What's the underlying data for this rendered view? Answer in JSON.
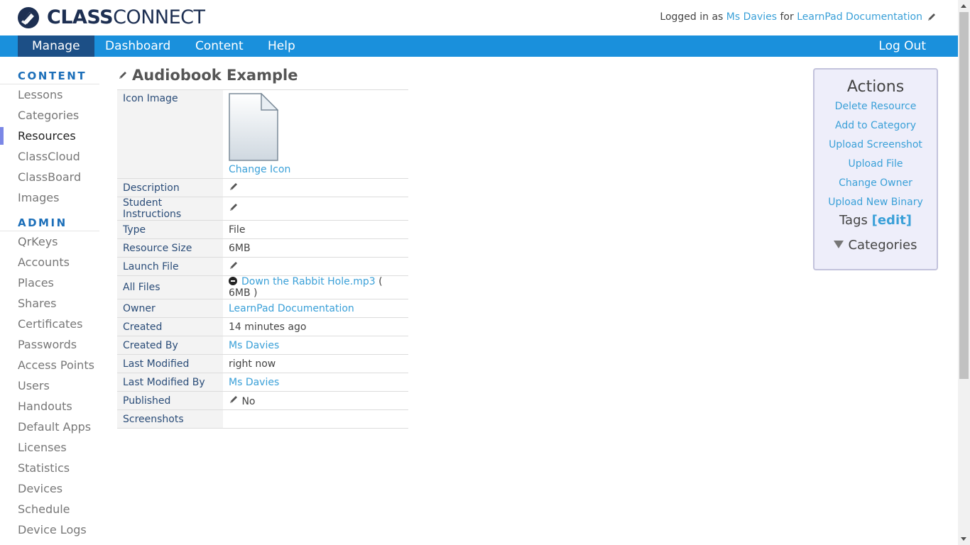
{
  "brand": {
    "text_bold": "CLASS",
    "text_light": "CONNECT",
    "color": "#1d2f52"
  },
  "login": {
    "prefix": "Logged in as ",
    "user": "Ms Davies",
    "middle": " for ",
    "org": "LearnPad Documentation"
  },
  "nav": {
    "items": [
      "Manage",
      "Dashboard",
      "Content",
      "Help"
    ],
    "active": "Manage",
    "logout": "Log Out",
    "color": "#1a90dc",
    "active_color": "#1c4f86"
  },
  "sidebar": {
    "content_heading": "CONTENT",
    "content_items": [
      "Lessons",
      "Categories",
      "Resources",
      "ClassCloud",
      "ClassBoard",
      "Images"
    ],
    "active": "Resources",
    "admin_heading": "ADMIN",
    "admin_items": [
      "QrKeys",
      "Accounts",
      "Places",
      "Shares",
      "Certificates",
      "Passwords",
      "Access Points",
      "Users",
      "Handouts",
      "Default Apps",
      "Licenses",
      "Statistics",
      "Devices",
      "Schedule",
      "Device Logs"
    ]
  },
  "resource": {
    "title": "Audiobook Example",
    "icon_label": "Icon Image",
    "change_icon": "Change Icon",
    "rows": {
      "description": {
        "label": "Description"
      },
      "student_instructions": {
        "label": "Student Instructions"
      },
      "type": {
        "label": "Type",
        "value": "File"
      },
      "resource_size": {
        "label": "Resource Size",
        "value": "6MB"
      },
      "launch_file": {
        "label": "Launch File"
      },
      "all_files": {
        "label": "All Files",
        "file_name": "Down the Rabbit Hole.mp3",
        "file_size": "( 6MB )"
      },
      "owner": {
        "label": "Owner",
        "value": "LearnPad Documentation"
      },
      "created": {
        "label": "Created",
        "value": "14 minutes ago"
      },
      "created_by": {
        "label": "Created By",
        "value": "Ms Davies"
      },
      "last_modified": {
        "label": "Last Modified",
        "value": "right now"
      },
      "last_modified_by": {
        "label": "Last Modified By",
        "value": "Ms Davies"
      },
      "published": {
        "label": "Published",
        "value": "No"
      },
      "screenshots": {
        "label": "Screenshots"
      }
    }
  },
  "actions": {
    "heading": "Actions",
    "links": [
      "Delete Resource",
      "Add to Category",
      "Upload Screenshot",
      "Upload File",
      "Change Owner",
      "Upload New Binary"
    ],
    "tags_label": "Tags",
    "tags_edit": "[edit]",
    "categories_label": "Categories"
  },
  "icons": {
    "logo": "classconnect-logo-icon",
    "pencil": "pencil-icon",
    "file": "blank-file-icon",
    "remove": "minus-circle-icon",
    "collapse": "triangle-down-icon"
  },
  "colors": {
    "link": "#3aa0d8",
    "label": "#2a4c78",
    "actions_bg": "#eeeefa",
    "active_marker": "#7b87e6"
  }
}
